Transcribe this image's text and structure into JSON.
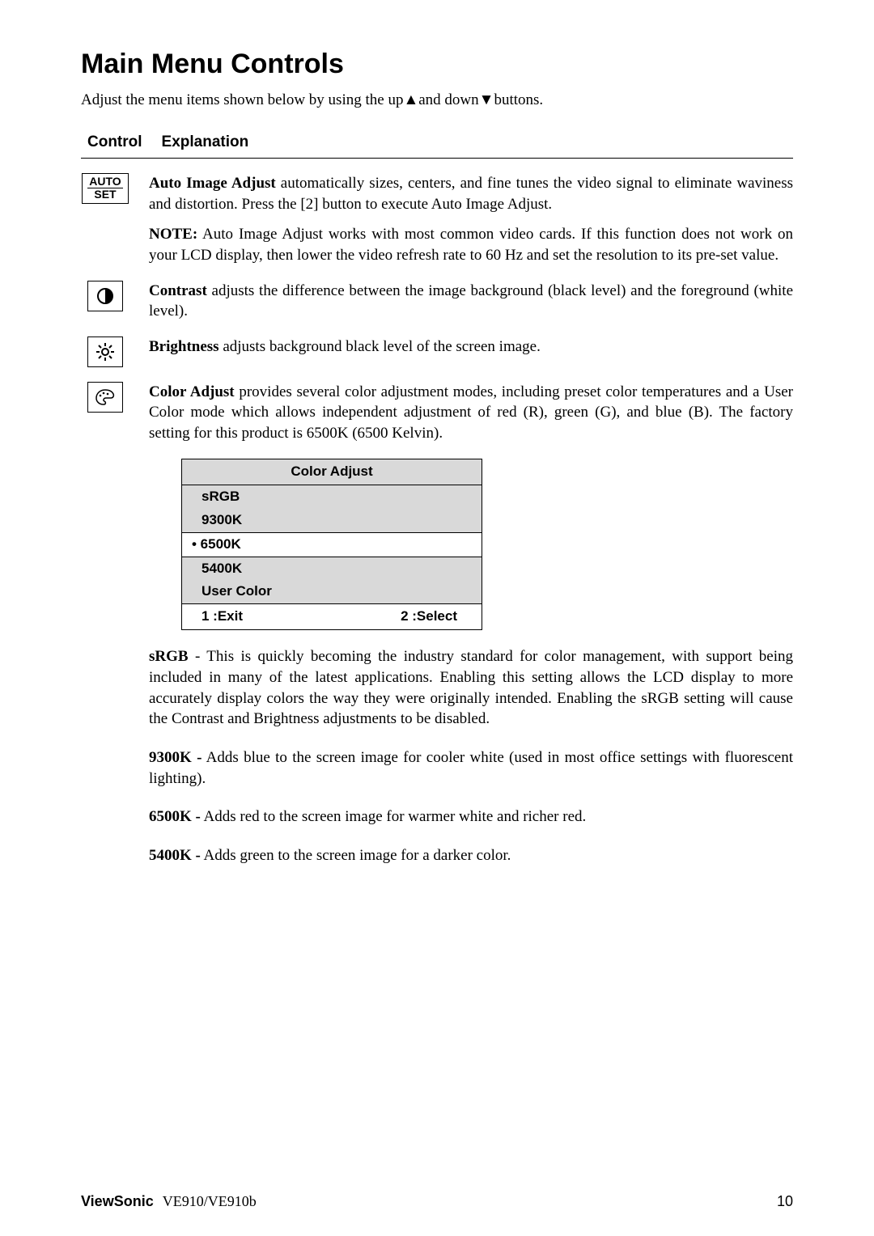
{
  "title": "Main Menu Controls",
  "intro": "Adjust the menu items shown below by using the up▲and down▼buttons.",
  "head": {
    "c1": "Control",
    "c2": "Explanation"
  },
  "autoset": {
    "line1": "AUTO",
    "line2": "SET"
  },
  "auto": {
    "p1a": "Auto Image Adjust",
    "p1b": " automatically sizes, centers, and fine tunes the video signal to eliminate waviness and distortion. Press the [2] button to execute Auto Image Adjust.",
    "p2a": "NOTE:",
    "p2b": " Auto Image Adjust works with most common video cards. If this function does not work on your LCD display, then lower the video refresh rate to 60 Hz and set the resolution to its pre-set value."
  },
  "contrast": {
    "a": "Contrast",
    "b": " adjusts the difference between the image background  (black level) and the foreground (white level)."
  },
  "brightness": {
    "a": "Brightness",
    "b": " adjusts background black level of the screen image."
  },
  "coloradj": {
    "a": "Color Adjust",
    "b": " provides several color adjustment modes, including preset color temperatures and a User Color mode which allows independent adjustment of red (R), green (G), and blue (B). The factory setting for this product is 6500K (6500 Kelvin)."
  },
  "menu": {
    "title": "Color Adjust",
    "r1": "sRGB",
    "r2": "9300K",
    "r3": "• 6500K",
    "r4": "5400K",
    "r5": "User Color",
    "f1": "1 :Exit",
    "f2": "2 :Select"
  },
  "srgb": {
    "a": "sRGB",
    "b": " - This is quickly becoming the industry standard for color management, with support being included in many of the latest applications. Enabling this setting allows the LCD display to more accurately display colors the way they were originally intended. Enabling the sRGB setting will cause the Contrast and Brightness adjustments to be disabled."
  },
  "k9300": {
    "a": "9300K -",
    "b": " Adds blue to the screen image for cooler white (used in most office settings with fluorescent lighting)."
  },
  "k6500": {
    "a": "6500K -",
    "b": " Adds red to the screen image for warmer white and richer red."
  },
  "k5400": {
    "a": "5400K -",
    "b": " Adds green to the screen image for a darker color."
  },
  "footer": {
    "brand": "ViewSonic",
    "model": "VE910/VE910b",
    "page": "10"
  }
}
